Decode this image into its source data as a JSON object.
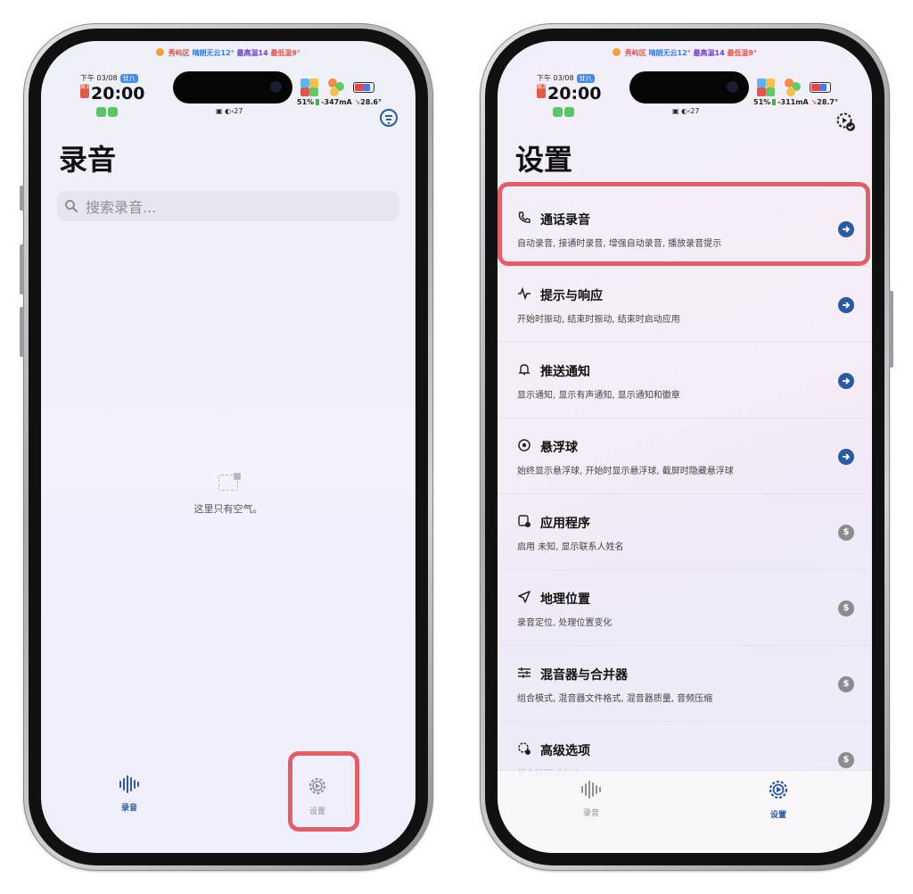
{
  "status_bar": {
    "weather_location": "秀屿区",
    "weather_text": "晴朗无云12°",
    "weather_high": "最高温14",
    "weather_low": "最低温9°",
    "date_prefix": "下午 03/08",
    "date_badge": "廿八",
    "clock_tag": "周五",
    "time": "20:00",
    "sub_status": "▣ ◐‹27"
  },
  "left_phone": {
    "battery_percent": "51%",
    "current": "-347mA",
    "temperature": "28.6°",
    "title": "录音",
    "search_placeholder": "搜索录音...",
    "empty_text": "这里只有空气。",
    "tabs": {
      "recordings": "录音",
      "settings": "设置"
    }
  },
  "right_phone": {
    "battery_percent": "51%",
    "current": "-311mA",
    "temperature": "28.7°",
    "title": "设置",
    "items": [
      {
        "title": "通话录音",
        "desc": "自动录音, 接通时录音, 增强自动录音, 播放录音提示",
        "icon": "phone-icon",
        "action": "arrow"
      },
      {
        "title": "提示与响应",
        "desc": "开始时振动, 结束时振动, 结束时启动应用",
        "icon": "pulse-icon",
        "action": "arrow"
      },
      {
        "title": "推送通知",
        "desc": "显示通知, 显示有声通知, 显示通知和徽章",
        "icon": "bell-icon",
        "action": "arrow"
      },
      {
        "title": "悬浮球",
        "desc": "始终显示悬浮球, 开始时显示悬浮球, 截屏时隐藏悬浮球",
        "icon": "target-icon",
        "action": "arrow"
      },
      {
        "title": "应用程序",
        "desc": "启用 未知, 显示联系人姓名",
        "icon": "app-icon",
        "action": "coin"
      },
      {
        "title": "地理位置",
        "desc": "录音定位, 处理位置变化",
        "icon": "location-icon",
        "action": "coin"
      },
      {
        "title": "混音器与合并器",
        "desc": "组合模式, 混音器文件格式, 混音器质量, 音频压缩",
        "icon": "sliders-icon",
        "action": "coin"
      },
      {
        "title": "高级选项",
        "desc": "首次解锁时启动",
        "icon": "advanced-gear-icon",
        "action": "coin"
      }
    ],
    "coin_label": "$",
    "tabs": {
      "recordings": "录音",
      "settings": "设置"
    }
  },
  "colors": {
    "accent": "#2b5aa0",
    "highlight": "#e06069",
    "coin": "#8c8c90"
  }
}
